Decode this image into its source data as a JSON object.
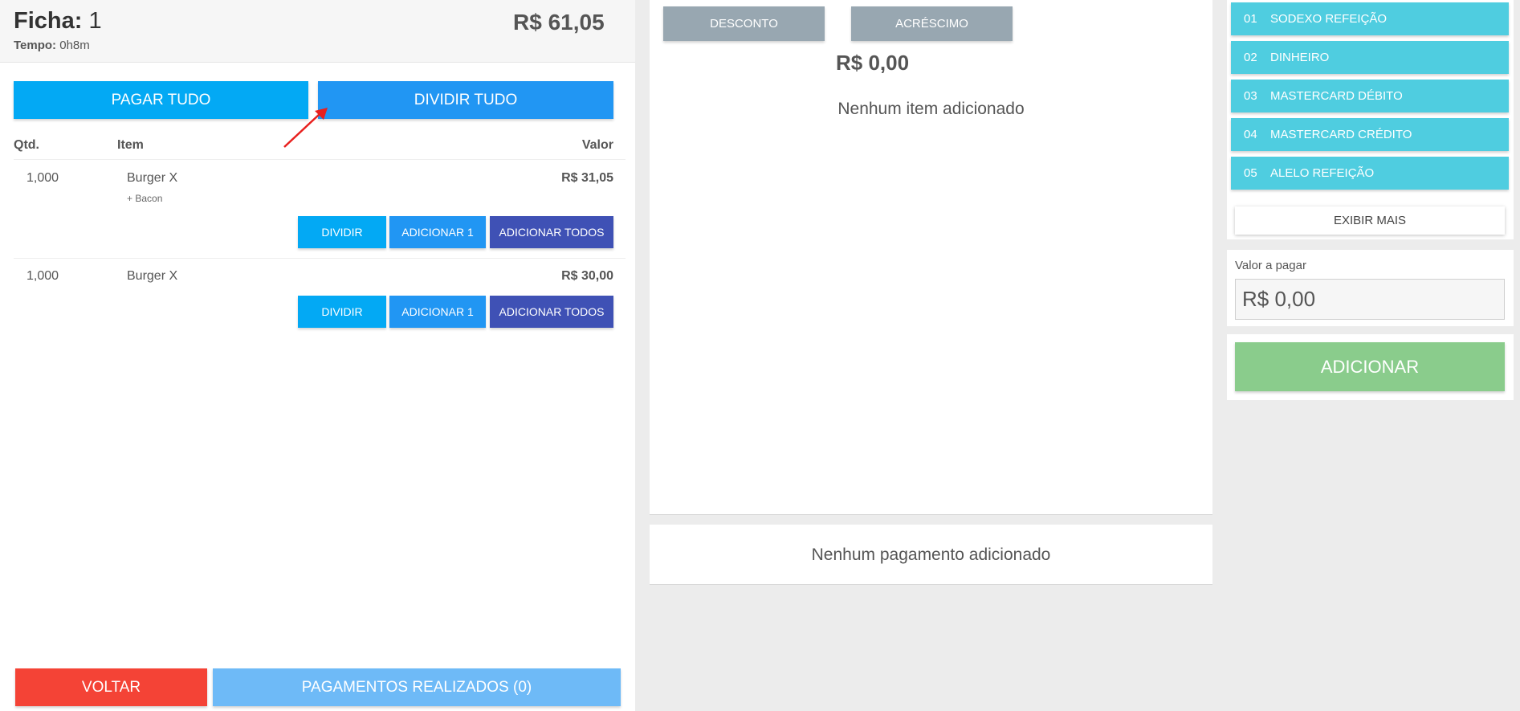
{
  "ticket": {
    "label": "Ficha:",
    "number": "1",
    "time_label": "Tempo:",
    "time_value": "0h8m",
    "total": "R$ 61,05"
  },
  "actions": {
    "pay_all": "PAGAR TUDO",
    "split_all": "DIVIDIR TUDO"
  },
  "table": {
    "headers": {
      "qty": "Qtd.",
      "item": "Item",
      "value": "Valor"
    },
    "rows": [
      {
        "qty": "1,000",
        "item": "Burger X",
        "addon": "+ Bacon",
        "value": "R$ 31,05",
        "btn_divide": "DIVIDIR",
        "btn_add_one": "ADICIONAR 1",
        "btn_add_all": "ADICIONAR TODOS"
      },
      {
        "qty": "1,000",
        "item": "Burger X",
        "addon": "",
        "value": "R$ 30,00",
        "btn_divide": "DIVIDIR",
        "btn_add_one": "ADICIONAR 1",
        "btn_add_all": "ADICIONAR TODOS"
      }
    ]
  },
  "footer": {
    "back": "VOLTAR",
    "payments_done": "PAGAMENTOS REALIZADOS (0)"
  },
  "middle": {
    "discount": "DESCONTO",
    "surcharge": "ACRÉSCIMO",
    "amount": "R$ 0,00",
    "empty_items": "Nenhum item adicionado",
    "empty_payments": "Nenhum pagamento adicionado"
  },
  "payment_methods": [
    {
      "code": "01",
      "name": "SODEXO REFEIÇÃO"
    },
    {
      "code": "02",
      "name": "DINHEIRO"
    },
    {
      "code": "03",
      "name": "MASTERCARD DÉBITO"
    },
    {
      "code": "04",
      "name": "MASTERCARD CRÉDITO"
    },
    {
      "code": "05",
      "name": "ALELO REFEIÇÃO"
    }
  ],
  "right": {
    "show_more": "EXIBIR MAIS",
    "value_label": "Valor a pagar",
    "value_input": "R$ 0,00",
    "add": "ADICIONAR"
  },
  "colors": {
    "pay_all": "#03a9f4",
    "split_all": "#2196f3",
    "add_all": "#3f51b5",
    "back": "#f44336",
    "payments_done": "#6ebaf7",
    "method": "#4fcde0",
    "add": "#8acc8c",
    "annotation_arrow": "#e8201e"
  }
}
